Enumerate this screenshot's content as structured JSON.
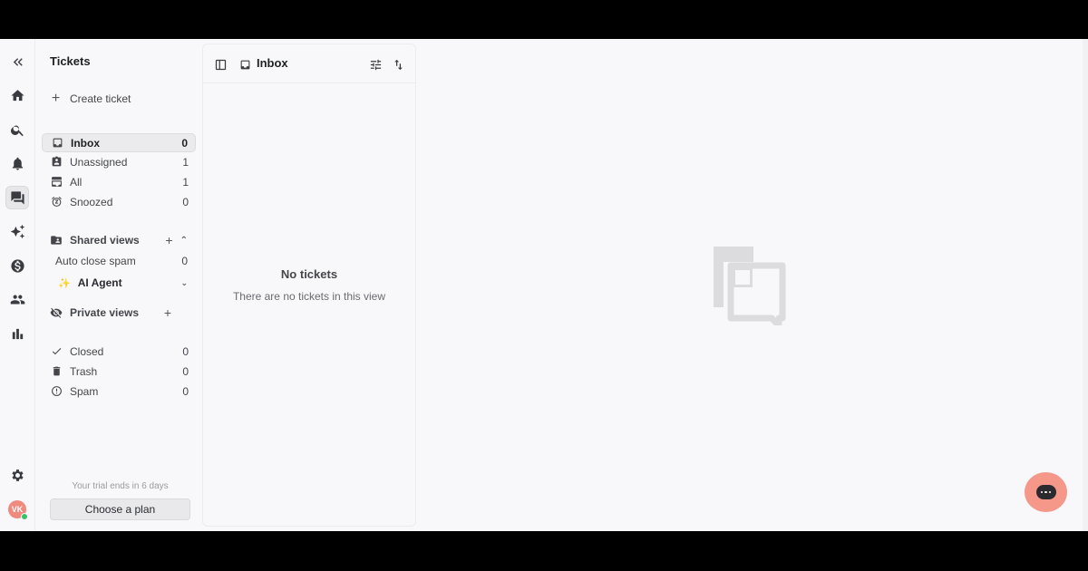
{
  "rail": {
    "items": [
      {
        "name": "collapse-icon"
      },
      {
        "name": "home-icon"
      },
      {
        "name": "search-icon"
      },
      {
        "name": "bell-icon"
      },
      {
        "name": "chat-icon",
        "active": true
      },
      {
        "name": "sparkle-icon"
      },
      {
        "name": "dollar-icon"
      },
      {
        "name": "people-icon"
      },
      {
        "name": "bar-chart-icon"
      }
    ],
    "settings_icon": "gear-icon",
    "avatar_initials": "VK",
    "avatar_color": "#f08a7e",
    "status_color": "#34c26b"
  },
  "sidebar": {
    "title": "Tickets",
    "create_label": "Create ticket",
    "nav": [
      {
        "label": "Inbox",
        "count": "0",
        "icon": "inbox-icon",
        "active": true
      },
      {
        "label": "Unassigned",
        "count": "1",
        "icon": "unassigned-icon"
      },
      {
        "label": "All",
        "count": "1",
        "icon": "all-icon"
      },
      {
        "label": "Snoozed",
        "count": "0",
        "icon": "alarm-icon"
      }
    ],
    "shared_views": {
      "label": "Shared views",
      "items": [
        {
          "label": "Auto close spam",
          "count": "0"
        },
        {
          "label": "AI Agent"
        }
      ]
    },
    "private_views": {
      "label": "Private views"
    },
    "bottom_nav": [
      {
        "label": "Closed",
        "count": "0",
        "icon": "check-icon"
      },
      {
        "label": "Trash",
        "count": "0",
        "icon": "trash-icon"
      },
      {
        "label": "Spam",
        "count": "0",
        "icon": "alert-icon"
      }
    ],
    "trial_text": "Your trial ends in 6 days",
    "plan_button": "Choose a plan"
  },
  "list": {
    "title": "Inbox",
    "empty_title": "No tickets",
    "empty_subtitle": "There are no tickets in this view"
  },
  "colors": {
    "background": "#f8f8fa",
    "accent_chat": "#f5988a"
  }
}
